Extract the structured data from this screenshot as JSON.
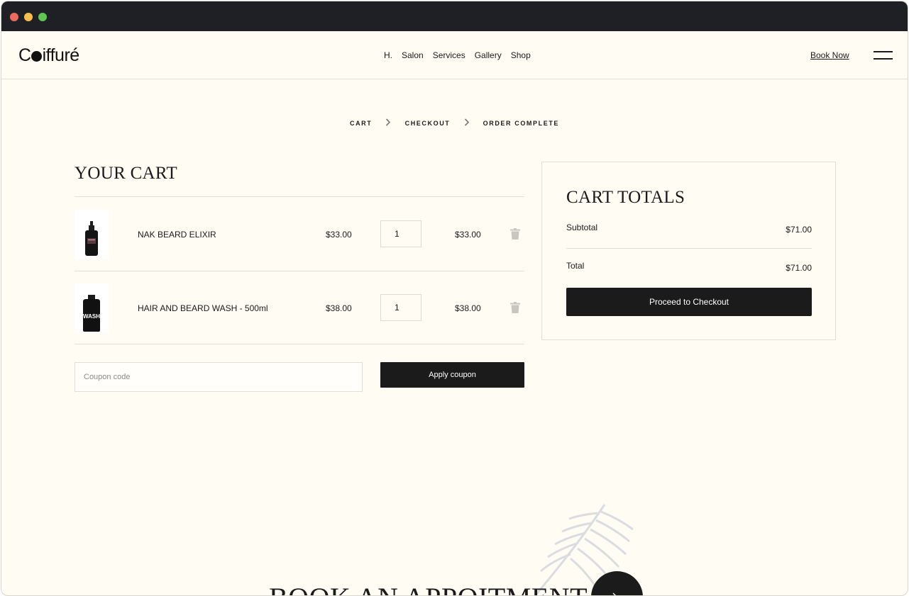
{
  "brand": {
    "logo_prefix": "C",
    "logo_suffix": "iffuré"
  },
  "nav": {
    "links": [
      "H.",
      "Salon",
      "Services",
      "Gallery",
      "Shop"
    ],
    "book_now": "Book Now"
  },
  "steps": [
    "CART",
    "CHECKOUT",
    "ORDER COMPLETE"
  ],
  "cart": {
    "title": "YOUR CART",
    "items": [
      {
        "name": "NAK BEARD ELIXIR",
        "price": "$33.00",
        "qty": "1",
        "total": "$33.00"
      },
      {
        "name": "HAIR AND BEARD WASH - 500ml",
        "price": "$38.00",
        "qty": "1",
        "total": "$38.00",
        "label": "WASH"
      }
    ],
    "coupon_placeholder": "Coupon code",
    "apply_label": "Apply coupon"
  },
  "totals": {
    "title": "CART TOTALS",
    "subtotal_label": "Subtotal",
    "subtotal_value": "$71.00",
    "total_label": "Total",
    "total_value": "$71.00",
    "checkout_label": "Proceed to Checkout"
  },
  "booking": {
    "heading": "BOOK AN APPOITMENT"
  },
  "colors": {
    "background": "#fffcf4",
    "titlebar": "#1f2025",
    "button": "#1b1b1b",
    "border": "#e2dfd6"
  }
}
